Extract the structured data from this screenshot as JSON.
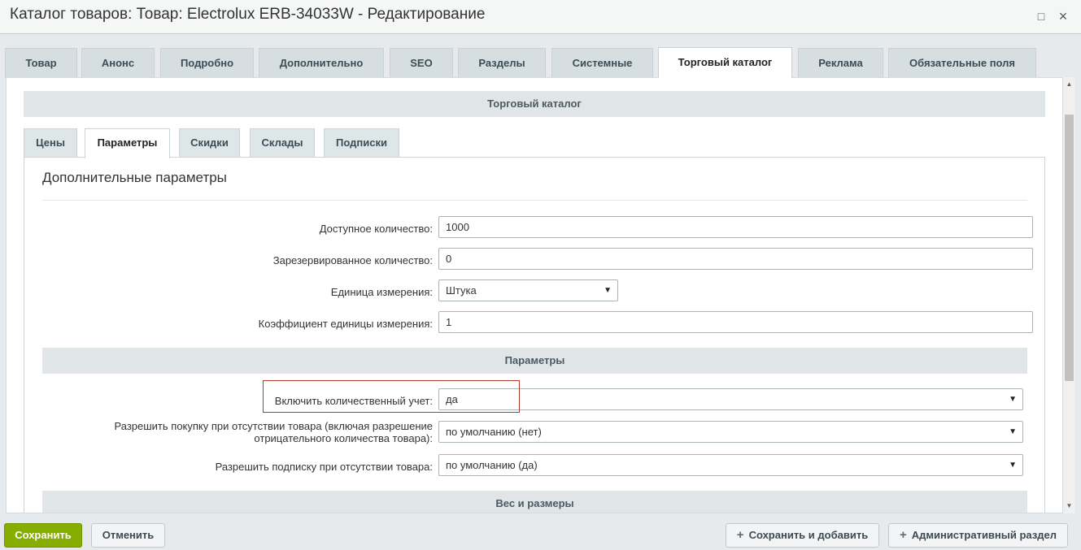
{
  "window": {
    "title": "Каталог товаров: Товар: Electrolux ERB-34033W - Редактирование",
    "maximize_icon": "□",
    "close_icon": "×"
  },
  "tabs": [
    {
      "label": "Товар"
    },
    {
      "label": "Анонс"
    },
    {
      "label": "Подробно"
    },
    {
      "label": "Дополнительно"
    },
    {
      "label": "SEO"
    },
    {
      "label": "Разделы"
    },
    {
      "label": "Системные"
    },
    {
      "label": "Торговый каталог",
      "active": true
    },
    {
      "label": "Реклама"
    },
    {
      "label": "Обязательные поля"
    }
  ],
  "catalog": {
    "header": "Торговый каталог",
    "subtabs": [
      {
        "label": "Цены"
      },
      {
        "label": "Параметры",
        "active": true
      },
      {
        "label": "Скидки"
      },
      {
        "label": "Склады"
      },
      {
        "label": "Подписки"
      }
    ],
    "panel_title": "Дополнительные параметры",
    "fields": {
      "available_label": "Доступное количество:",
      "available_value": "1000",
      "reserved_label": "Зарезервированное количество:",
      "reserved_value": "0",
      "unit_label": "Единица измерения:",
      "unit_value": "Штука",
      "ratio_label": "Коэффициент единицы измерения:",
      "ratio_value": "1"
    },
    "params_header": "Параметры",
    "params": {
      "quantity_trace_label": "Включить количественный учет:",
      "quantity_trace_value": "да",
      "can_buy_zero_label_line1": "Разрешить покупку при отсутствии товара (включая разрешение",
      "can_buy_zero_label_line2": "отрицательного количества товара):",
      "can_buy_zero_value": "по умолчанию (нет)",
      "subscribe_label": "Разрешить подписку при отсутствии товара:",
      "subscribe_value": "по умолчанию (да)"
    },
    "weight_header": "Вес и размеры"
  },
  "footer": {
    "save": "Сохранить",
    "cancel": "Отменить",
    "save_and_add": "Сохранить и добавить",
    "admin_section": "Административный раздел"
  },
  "colors": {
    "primary_button": "#86ad00",
    "highlight_border": "#b03a2e",
    "tab_background": "#d6dee1",
    "section_header": "#e0e6e8"
  },
  "icons": {
    "dropdown": "▼",
    "plus": "+",
    "scroll_up": "▲",
    "scroll_down": "▼"
  }
}
